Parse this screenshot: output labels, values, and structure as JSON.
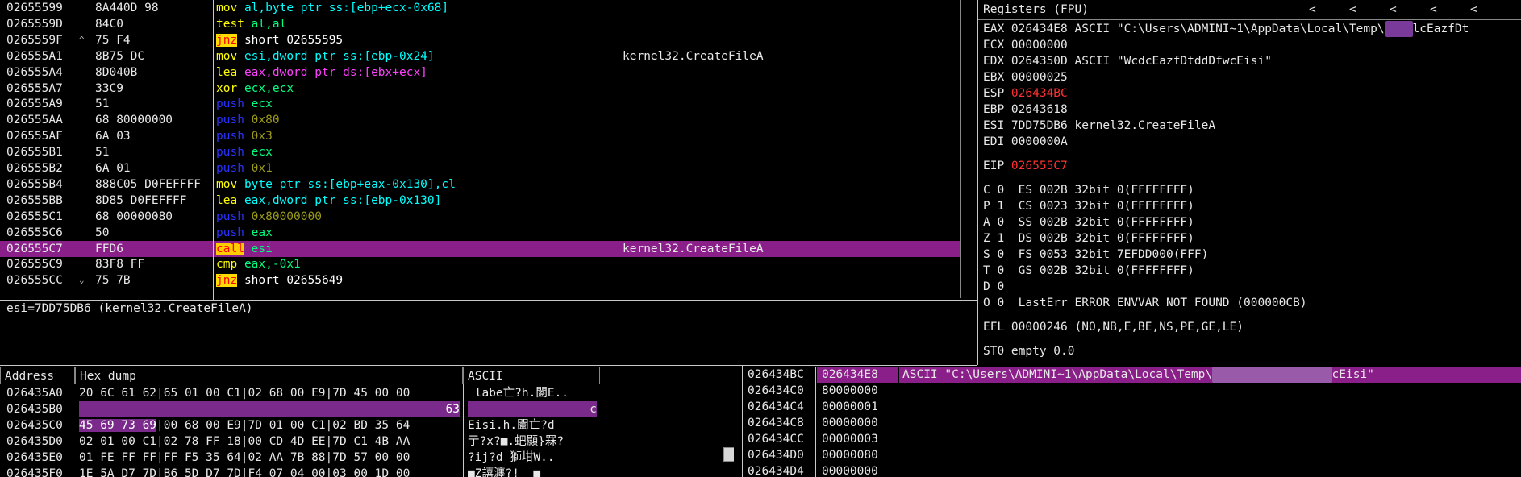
{
  "colors": {
    "mnemonic": "#ffff00",
    "operand": "#00ff7f",
    "push": "#2a32ff",
    "imm": "#8a8a1a",
    "call_bg": "#ffcc00",
    "call_fg": "#ff0000",
    "jmp_bg": "#ffdd00",
    "jmp_fg": "#ff0000",
    "xor": "#00d0ff",
    "lea": "#ff40ff",
    "sel": "#8a1f8a",
    "red": "#ff3030"
  },
  "disasm": [
    {
      "addr": "02655599",
      "mark": "",
      "hex": "8A440D 98",
      "mn": "mov",
      "mnc": "#00ffff",
      "ops": [
        {
          "t": "al,",
          "c": "#00ffff"
        },
        {
          "t": "byte ptr ss:[ebp+ecx-0x68]",
          "c": "#00ffff"
        }
      ],
      "cmt": ""
    },
    {
      "addr": "0265559D",
      "mark": "",
      "hex": "84C0",
      "mn": "test",
      "mnc": "#ffff00",
      "ops": [
        {
          "t": "al,al",
          "c": "#00ff7f"
        }
      ],
      "cmt": ""
    },
    {
      "addr": "0265559F",
      "mark": "^",
      "hex": "75 F4",
      "mn": "jnz",
      "mnc": "jmp",
      "ops": [
        {
          "t": "short 02655595",
          "c": "#ffffff"
        }
      ],
      "cmt": ""
    },
    {
      "addr": "026555A1",
      "mark": "",
      "hex": "8B75 DC",
      "mn": "mov",
      "mnc": "#00ffff",
      "ops": [
        {
          "t": "esi,dword ptr ss:[ebp-0x24]",
          "c": "#00ffff"
        }
      ],
      "cmt": "kernel32.CreateFileA"
    },
    {
      "addr": "026555A4",
      "mark": "",
      "hex": "8D040B",
      "mn": "lea",
      "mnc": "#00ff7f",
      "ops": [
        {
          "t": "eax,dword ptr ds:[ebx+ecx]",
          "c": "#ff40ff"
        }
      ],
      "cmt": ""
    },
    {
      "addr": "026555A7",
      "mark": "",
      "hex": "33C9",
      "mn": "xor",
      "mnc": "#00ff7f",
      "ops": [
        {
          "t": "ecx,ecx",
          "c": "#00ff7f"
        }
      ],
      "cmt": ""
    },
    {
      "addr": "026555A9",
      "mark": "",
      "hex": "51",
      "mn": "push",
      "mnc": "#2a32ff",
      "ops": [
        {
          "t": "ecx",
          "c": "#00ff7f"
        }
      ],
      "cmt": ""
    },
    {
      "addr": "026555AA",
      "mark": "",
      "hex": "68 80000000",
      "mn": "push",
      "mnc": "#2a32ff",
      "ops": [
        {
          "t": "0x80",
          "c": "#9a9a1a"
        }
      ],
      "cmt": ""
    },
    {
      "addr": "026555AF",
      "mark": "",
      "hex": "6A 03",
      "mn": "push",
      "mnc": "#2a32ff",
      "ops": [
        {
          "t": "0x3",
          "c": "#9a9a1a"
        }
      ],
      "cmt": ""
    },
    {
      "addr": "026555B1",
      "mark": "",
      "hex": "51",
      "mn": "push",
      "mnc": "#2a32ff",
      "ops": [
        {
          "t": "ecx",
          "c": "#00ff7f"
        }
      ],
      "cmt": ""
    },
    {
      "addr": "026555B2",
      "mark": "",
      "hex": "6A 01",
      "mn": "push",
      "mnc": "#2a32ff",
      "ops": [
        {
          "t": "0x1",
          "c": "#9a9a1a"
        }
      ],
      "cmt": ""
    },
    {
      "addr": "026555B4",
      "mark": "",
      "hex": "888C05 D0FEFFFF",
      "mn": "mov",
      "mnc": "#00ffff",
      "ops": [
        {
          "t": "byte ptr ss:[ebp+eax-0x130],cl",
          "c": "#00ffff"
        }
      ],
      "cmt": ""
    },
    {
      "addr": "026555BB",
      "mark": "",
      "hex": "8D85 D0FEFFFF",
      "mn": "lea",
      "mnc": "#00ff7f",
      "ops": [
        {
          "t": "eax,dword ptr ss:[ebp-0x130]",
          "c": "#00ffff"
        }
      ],
      "cmt": ""
    },
    {
      "addr": "026555C1",
      "mark": "",
      "hex": "68 00000080",
      "mn": "push",
      "mnc": "#2a32ff",
      "ops": [
        {
          "t": "0x80000000",
          "c": "#9a9a1a"
        }
      ],
      "cmt": ""
    },
    {
      "addr": "026555C6",
      "mark": "",
      "hex": "50",
      "mn": "push",
      "mnc": "#2a32ff",
      "ops": [
        {
          "t": "eax",
          "c": "#00ff7f"
        }
      ],
      "cmt": ""
    },
    {
      "addr": "026555C7",
      "mark": "",
      "hex": "FFD6",
      "mn": "call",
      "mnc": "call",
      "ops": [
        {
          "t": "esi",
          "c": "#00ff7f"
        }
      ],
      "cmt": "kernel32.CreateFileA",
      "sel": true
    },
    {
      "addr": "026555C9",
      "mark": "",
      "hex": "83F8 FF",
      "mn": "cmp",
      "mnc": "#00ff7f",
      "ops": [
        {
          "t": "eax,-0x1",
          "c": "#00ff7f"
        }
      ],
      "cmt": ""
    },
    {
      "addr": "026555CC",
      "mark": "v",
      "hex": "75 7B",
      "mn": "jnz",
      "mnc": "jmp",
      "ops": [
        {
          "t": "short 02655649",
          "c": "#ffffff"
        }
      ],
      "cmt": ""
    }
  ],
  "info_line": "esi=7DD75DB6 (kernel32.CreateFileA)",
  "registers": {
    "title": "Registers (FPU)",
    "nav": [
      "<",
      "<",
      "<",
      "<",
      "<"
    ],
    "rows": [
      {
        "t": "EAX 026434E8 ASCII \"C:\\Users\\ADMINI~1\\AppData\\Local\\Temp\\",
        "blur": "    ",
        "t2": "lcEazfDt",
        "red": false
      },
      {
        "t": "ECX 00000000",
        "red": false
      },
      {
        "t": "EDX 0264350D ASCII \"WcdcEazfDtddDfwcEisi\"",
        "red": false
      },
      {
        "t": "EBX 00000025",
        "red": false
      },
      {
        "lab": "ESP ",
        "val": "026434BC",
        "red": true
      },
      {
        "t": "EBP 02643618",
        "red": false
      },
      {
        "t": "ESI 7DD75DB6 kernel32.CreateFileA",
        "red": false
      },
      {
        "t": "EDI 0000000A",
        "red": false
      },
      {
        "t": "",
        "red": false,
        "gap": true
      },
      {
        "lab": "EIP ",
        "val": "026555C7",
        "red": true
      },
      {
        "t": "",
        "red": false,
        "gap": true
      },
      {
        "t": "C 0  ES 002B 32bit 0(FFFFFFFF)",
        "red": false
      },
      {
        "t": "P 1  CS 0023 32bit 0(FFFFFFFF)",
        "red": false
      },
      {
        "t": "A 0  SS 002B 32bit 0(FFFFFFFF)",
        "red": false
      },
      {
        "t": "Z 1  DS 002B 32bit 0(FFFFFFFF)",
        "red": false
      },
      {
        "t": "S 0  FS 0053 32bit 7EFDD000(FFF)",
        "red": false
      },
      {
        "t": "T 0  GS 002B 32bit 0(FFFFFFFF)",
        "red": false
      },
      {
        "t": "D 0",
        "red": false
      },
      {
        "t": "O 0  LastErr ERROR_ENVVAR_NOT_FOUND (000000CB)",
        "red": false
      },
      {
        "t": "",
        "red": false,
        "gap": true
      },
      {
        "t": "EFL 00000246 (NO,NB,E,BE,NS,PE,GE,LE)",
        "red": false
      },
      {
        "t": "",
        "red": false,
        "gap": true
      },
      {
        "t": "ST0 empty 0.0",
        "red": false
      }
    ]
  },
  "dump": {
    "headers": {
      "address": "Address",
      "hex": "Hex dump",
      "ascii": "ASCII"
    },
    "rows": [
      {
        "addr": "026435A0",
        "hex": "20 6C 61 62|65 01 00 C1|02 68 00 E9|7D 45 00 00",
        "ascii": " labe亡?h.闔E..",
        "hl": 0
      },
      {
        "addr": "026435B0",
        "hex": "                                            63",
        "ascii": "               c",
        "hl": 1
      },
      {
        "addr": "026435C0",
        "hex": "45 69 73 69|00 68 00 E9|7D 01 00 C1|02 BD 35 64",
        "ascii": "Eisi.h.闔亡?d",
        "hl": 2
      },
      {
        "addr": "026435D0",
        "hex": "02 01 00 C1|02 78 FF 18|00 CD 4D EE|7D C1 4B AA",
        "ascii": "亍?x?■.蚆顯}罧?",
        "hl": 0
      },
      {
        "addr": "026435E0",
        "hex": "01 FE FF FF|FF F5 35 64|02 AA 7B 88|7D 57 00 00",
        "ascii": "?ij?d 獅坩W..",
        "hl": 0
      },
      {
        "addr": "026435F0",
        "hex": "1E 5A D7 7D|B6 5D D7 7D|F4 07 04 00|03 00 1D 00",
        "ascii": "■Z譆瀍?!  ■",
        "hl": 0
      }
    ]
  },
  "stack": {
    "rows": [
      {
        "addr": "026434BC",
        "val": "026434E8",
        "cmt": "ASCII \"C:\\Users\\ADMINI~1\\AppData\\Local\\Temp\\",
        "cmt2": "cEisi\"",
        "sel": true
      },
      {
        "addr": "026434C0",
        "val": "80000000",
        "cmt": ""
      },
      {
        "addr": "026434C4",
        "val": "00000001",
        "cmt": ""
      },
      {
        "addr": "026434C8",
        "val": "00000000",
        "cmt": ""
      },
      {
        "addr": "026434CC",
        "val": "00000003",
        "cmt": ""
      },
      {
        "addr": "026434D0",
        "val": "00000080",
        "cmt": ""
      },
      {
        "addr": "026434D4",
        "val": "00000000",
        "cmt": ""
      }
    ]
  }
}
